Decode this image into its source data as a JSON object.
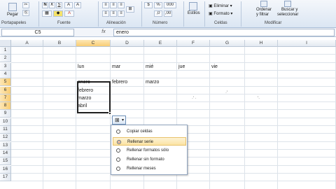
{
  "ribbon": {
    "groups": {
      "portapapeles": "Portapapeles",
      "fuente": "Fuente",
      "alineacion": "Alineación",
      "numero": "Número",
      "celdas": "Celdas",
      "modificar": "Modificar"
    },
    "pegar": "Pegar",
    "estilos": "Estilos",
    "eliminar": "Eliminar",
    "formato": "Formato",
    "ordenar": "Ordenar",
    "ordenar2": "y filtrar",
    "buscar": "Buscar y",
    "buscar2": "seleccionar",
    "percent": "%",
    "thousands": "000"
  },
  "formula_bar": {
    "name_box": "C5",
    "fx": "fx",
    "value": "enero"
  },
  "columns": [
    "A",
    "B",
    "C",
    "D",
    "E",
    "F",
    "G",
    "H",
    "I"
  ],
  "selected_column": "C",
  "rows": [
    "1",
    "2",
    "3",
    "4",
    "5",
    "6",
    "7",
    "8",
    "9",
    "10",
    "11",
    "12",
    "13",
    "14",
    "15",
    "16",
    "17"
  ],
  "selected_rows": [
    "5",
    "6",
    "7",
    "8"
  ],
  "cells": {
    "C3": "lun",
    "D3": "mar",
    "E3": "mié",
    "F3": "jue",
    "G3": "vie",
    "C5": "enero",
    "D5": "febrero",
    "E5": "marzo",
    "C6": "febrero",
    "C7": "marzo",
    "C8": "abril"
  },
  "autofill_menu": {
    "items": [
      {
        "label": "Copiar celdas",
        "selected": false
      },
      {
        "label": "Rellenar serie",
        "selected": true
      },
      {
        "label": "Rellenar formatos sólo",
        "selected": false
      },
      {
        "label": "Rellenar sin formato",
        "selected": false
      },
      {
        "label": "Rellenar meses",
        "selected": false
      }
    ]
  }
}
